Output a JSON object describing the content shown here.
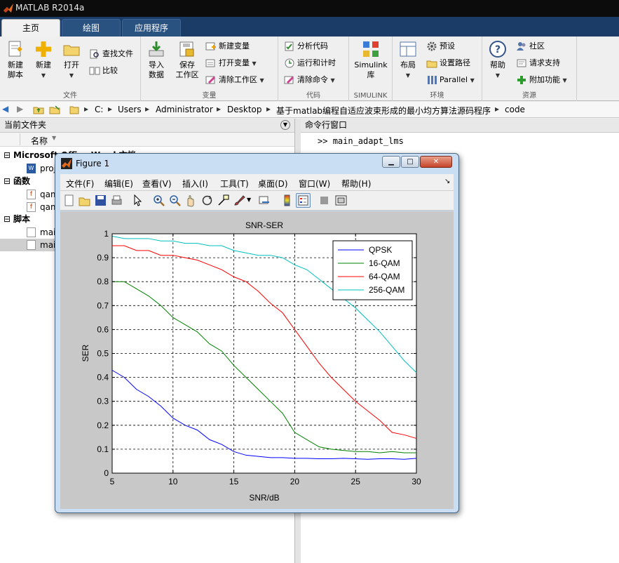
{
  "app": {
    "title": "MATLAB R2014a",
    "tabs": [
      {
        "label": "主页",
        "active": true
      },
      {
        "label": "绘图",
        "active": false
      },
      {
        "label": "应用程序",
        "active": false
      }
    ]
  },
  "ribbon": {
    "file": {
      "label": "文件",
      "new_script": "新建\n脚本",
      "new": "新建",
      "open": "打开",
      "find_files": "查找文件",
      "compare": "比较"
    },
    "variable": {
      "label": "变量",
      "import_data": "导入\n数据",
      "save_workspace": "保存\n工作区",
      "new_variable": "新建变量",
      "open_variable": "打开变量",
      "clear_workspace": "清除工作区"
    },
    "code": {
      "label": "代码",
      "analyze_code": "分析代码",
      "run_and_time": "运行和计时",
      "clear_commands": "清除命令"
    },
    "simulink": {
      "label": "SIMULINK",
      "library": "Simulink\n库"
    },
    "environment": {
      "label": "环境",
      "layout": "布局",
      "preferences": "预设",
      "set_path": "设置路径",
      "parallel": "Parallel"
    },
    "resources": {
      "label": "资源",
      "help": "帮助",
      "community": "社区",
      "request_support": "请求支持",
      "add_ons": "附加功能"
    }
  },
  "address": {
    "segments": [
      "C:",
      "Users",
      "Administrator",
      "Desktop",
      "基于matlab编程自适应波束形成的最小均方算法源码程序",
      "code"
    ]
  },
  "current_folder": {
    "title": "当前文件夹",
    "column_name": "名称",
    "groups": [
      {
        "title": "Microsoft Office Word 文档",
        "items": [
          "proj"
        ]
      },
      {
        "title": "函数",
        "items": [
          "qam",
          "qam"
        ]
      },
      {
        "title": "脚本",
        "items": [
          "main",
          "main"
        ]
      }
    ]
  },
  "command_window": {
    "title": "命令行窗口",
    "prompt": ">>",
    "command": "main_adapt_lms"
  },
  "figure": {
    "title": "Figure 1",
    "menu": [
      "文件(F)",
      "编辑(E)",
      "查看(V)",
      "插入(I)",
      "工具(T)",
      "桌面(D)",
      "窗口(W)",
      "帮助(H)"
    ]
  },
  "chart_data": {
    "type": "line",
    "title": "SNR-SER",
    "xlabel": "SNR/dB",
    "ylabel": "SER",
    "xlim": [
      5,
      30
    ],
    "ylim": [
      0,
      1
    ],
    "xticks": [
      5,
      10,
      15,
      20,
      25,
      30
    ],
    "yticks": [
      0,
      0.1,
      0.2,
      0.3,
      0.4,
      0.5,
      0.6,
      0.7,
      0.8,
      0.9,
      1
    ],
    "grid": true,
    "legend_position": "top-right",
    "x": [
      5,
      6,
      7,
      8,
      9,
      10,
      11,
      12,
      13,
      14,
      15,
      16,
      17,
      18,
      19,
      20,
      21,
      22,
      23,
      24,
      25,
      26,
      27,
      28,
      29,
      30
    ],
    "series": [
      {
        "name": "QPSK",
        "color": "#0000ff",
        "values": [
          0.43,
          0.4,
          0.35,
          0.32,
          0.28,
          0.23,
          0.2,
          0.18,
          0.14,
          0.12,
          0.09,
          0.075,
          0.07,
          0.065,
          0.065,
          0.062,
          0.062,
          0.06,
          0.06,
          0.062,
          0.06,
          0.058,
          0.06,
          0.06,
          0.058,
          0.062
        ]
      },
      {
        "name": "16-QAM",
        "color": "#008000",
        "values": [
          0.8,
          0.8,
          0.77,
          0.74,
          0.7,
          0.65,
          0.62,
          0.59,
          0.54,
          0.51,
          0.45,
          0.4,
          0.35,
          0.3,
          0.25,
          0.17,
          0.14,
          0.11,
          0.1,
          0.095,
          0.09,
          0.09,
          0.085,
          0.09,
          0.085,
          0.085
        ]
      },
      {
        "name": "64-QAM",
        "color": "#ff0000",
        "values": [
          0.95,
          0.95,
          0.93,
          0.93,
          0.91,
          0.91,
          0.9,
          0.89,
          0.87,
          0.85,
          0.82,
          0.8,
          0.76,
          0.71,
          0.67,
          0.6,
          0.53,
          0.46,
          0.4,
          0.35,
          0.3,
          0.26,
          0.22,
          0.17,
          0.16,
          0.145
        ]
      },
      {
        "name": "256-QAM",
        "color": "#00bfbf",
        "values": [
          0.99,
          0.98,
          0.98,
          0.98,
          0.97,
          0.97,
          0.96,
          0.96,
          0.95,
          0.95,
          0.93,
          0.92,
          0.91,
          0.91,
          0.9,
          0.87,
          0.85,
          0.81,
          0.77,
          0.73,
          0.69,
          0.64,
          0.59,
          0.53,
          0.47,
          0.42
        ]
      }
    ]
  }
}
